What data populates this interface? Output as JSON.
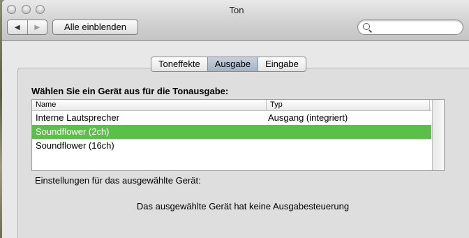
{
  "window": {
    "title": "Ton"
  },
  "toolbar": {
    "back_label": "◀",
    "forward_label": "▶",
    "show_all_label": "Alle einblenden",
    "search": {
      "value": "",
      "placeholder": ""
    }
  },
  "tabs": [
    {
      "label": "Toneffekte",
      "active": false
    },
    {
      "label": "Ausgabe",
      "active": true
    },
    {
      "label": "Eingabe",
      "active": false
    }
  ],
  "output": {
    "heading": "Wählen Sie ein Gerät aus für die Tonausgabe:",
    "columns": [
      "Name",
      "Typ"
    ],
    "rows": [
      {
        "name": "Interne Lautsprecher",
        "type": "Ausgang (integriert)"
      },
      {
        "name": "Soundflower (2ch)",
        "type": ""
      },
      {
        "name": "Soundflower (16ch)",
        "type": ""
      }
    ],
    "selected_row": 1,
    "settings_label": "Einstellungen für das ausgewählte Gerät:",
    "no_controls_message": "Das ausgewählte Gerät hat keine Ausgabesteuerung"
  },
  "colors": {
    "selection": "#5cbf49",
    "window_bg": "#e8e8e8"
  }
}
